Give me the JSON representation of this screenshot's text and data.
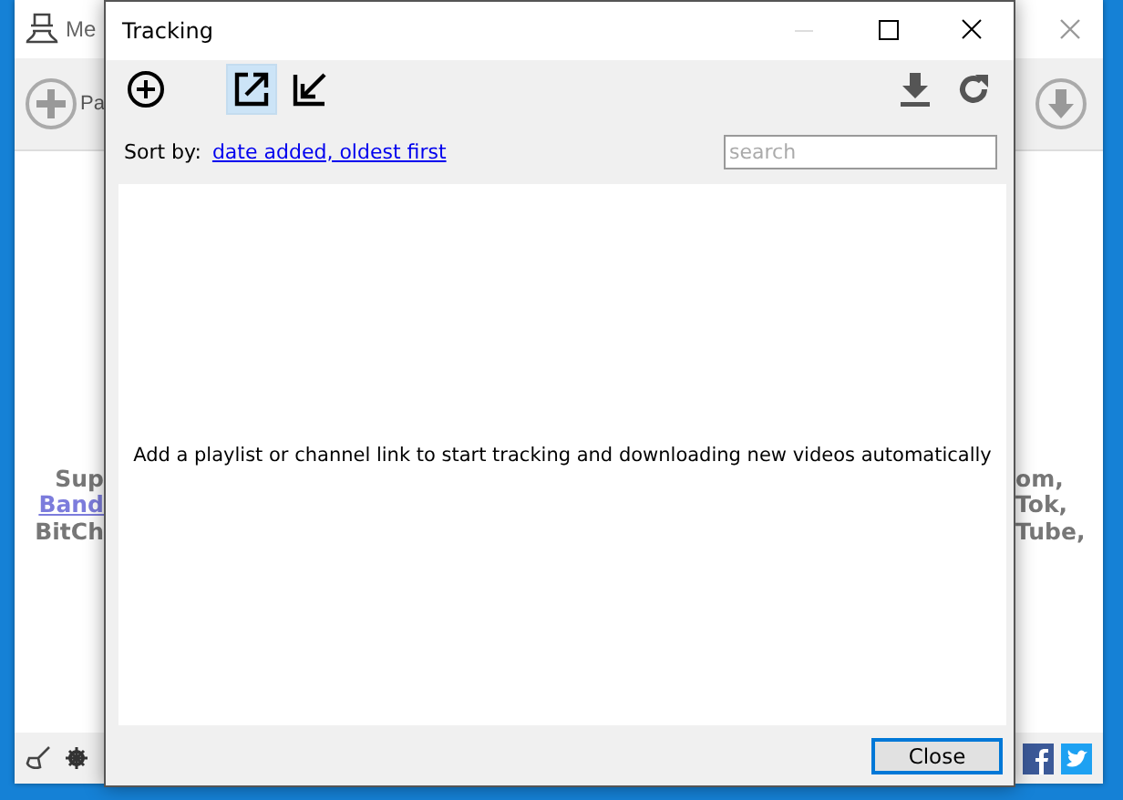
{
  "background_window": {
    "title": "Me",
    "toolbar_label": "Pa",
    "left_lines": [
      {
        "text": "Sup",
        "kind": "text"
      },
      {
        "text": "Band",
        "kind": "link"
      },
      {
        "text": "BitCh",
        "kind": "text"
      }
    ],
    "right_lines": [
      {
        "text": "om,",
        "kind": "text"
      },
      {
        "text": "Tok,",
        "kind": "text"
      },
      {
        "text": "Tube,",
        "kind": "text"
      }
    ]
  },
  "dialog": {
    "title": "Tracking",
    "tools_left": [
      {
        "kind": "add",
        "selected": false
      },
      {
        "kind": "export",
        "selected": true
      },
      {
        "kind": "import",
        "selected": false
      }
    ],
    "tools_right": [
      {
        "kind": "download",
        "selected": false
      },
      {
        "kind": "refresh",
        "selected": false
      }
    ],
    "sort_label": "Sort by:",
    "sort_value": "date added, oldest first",
    "search": {
      "placeholder": "search"
    },
    "empty_message": "Add a playlist or channel link to start tracking and downloading new videos automatically",
    "close_button": "Close"
  }
}
